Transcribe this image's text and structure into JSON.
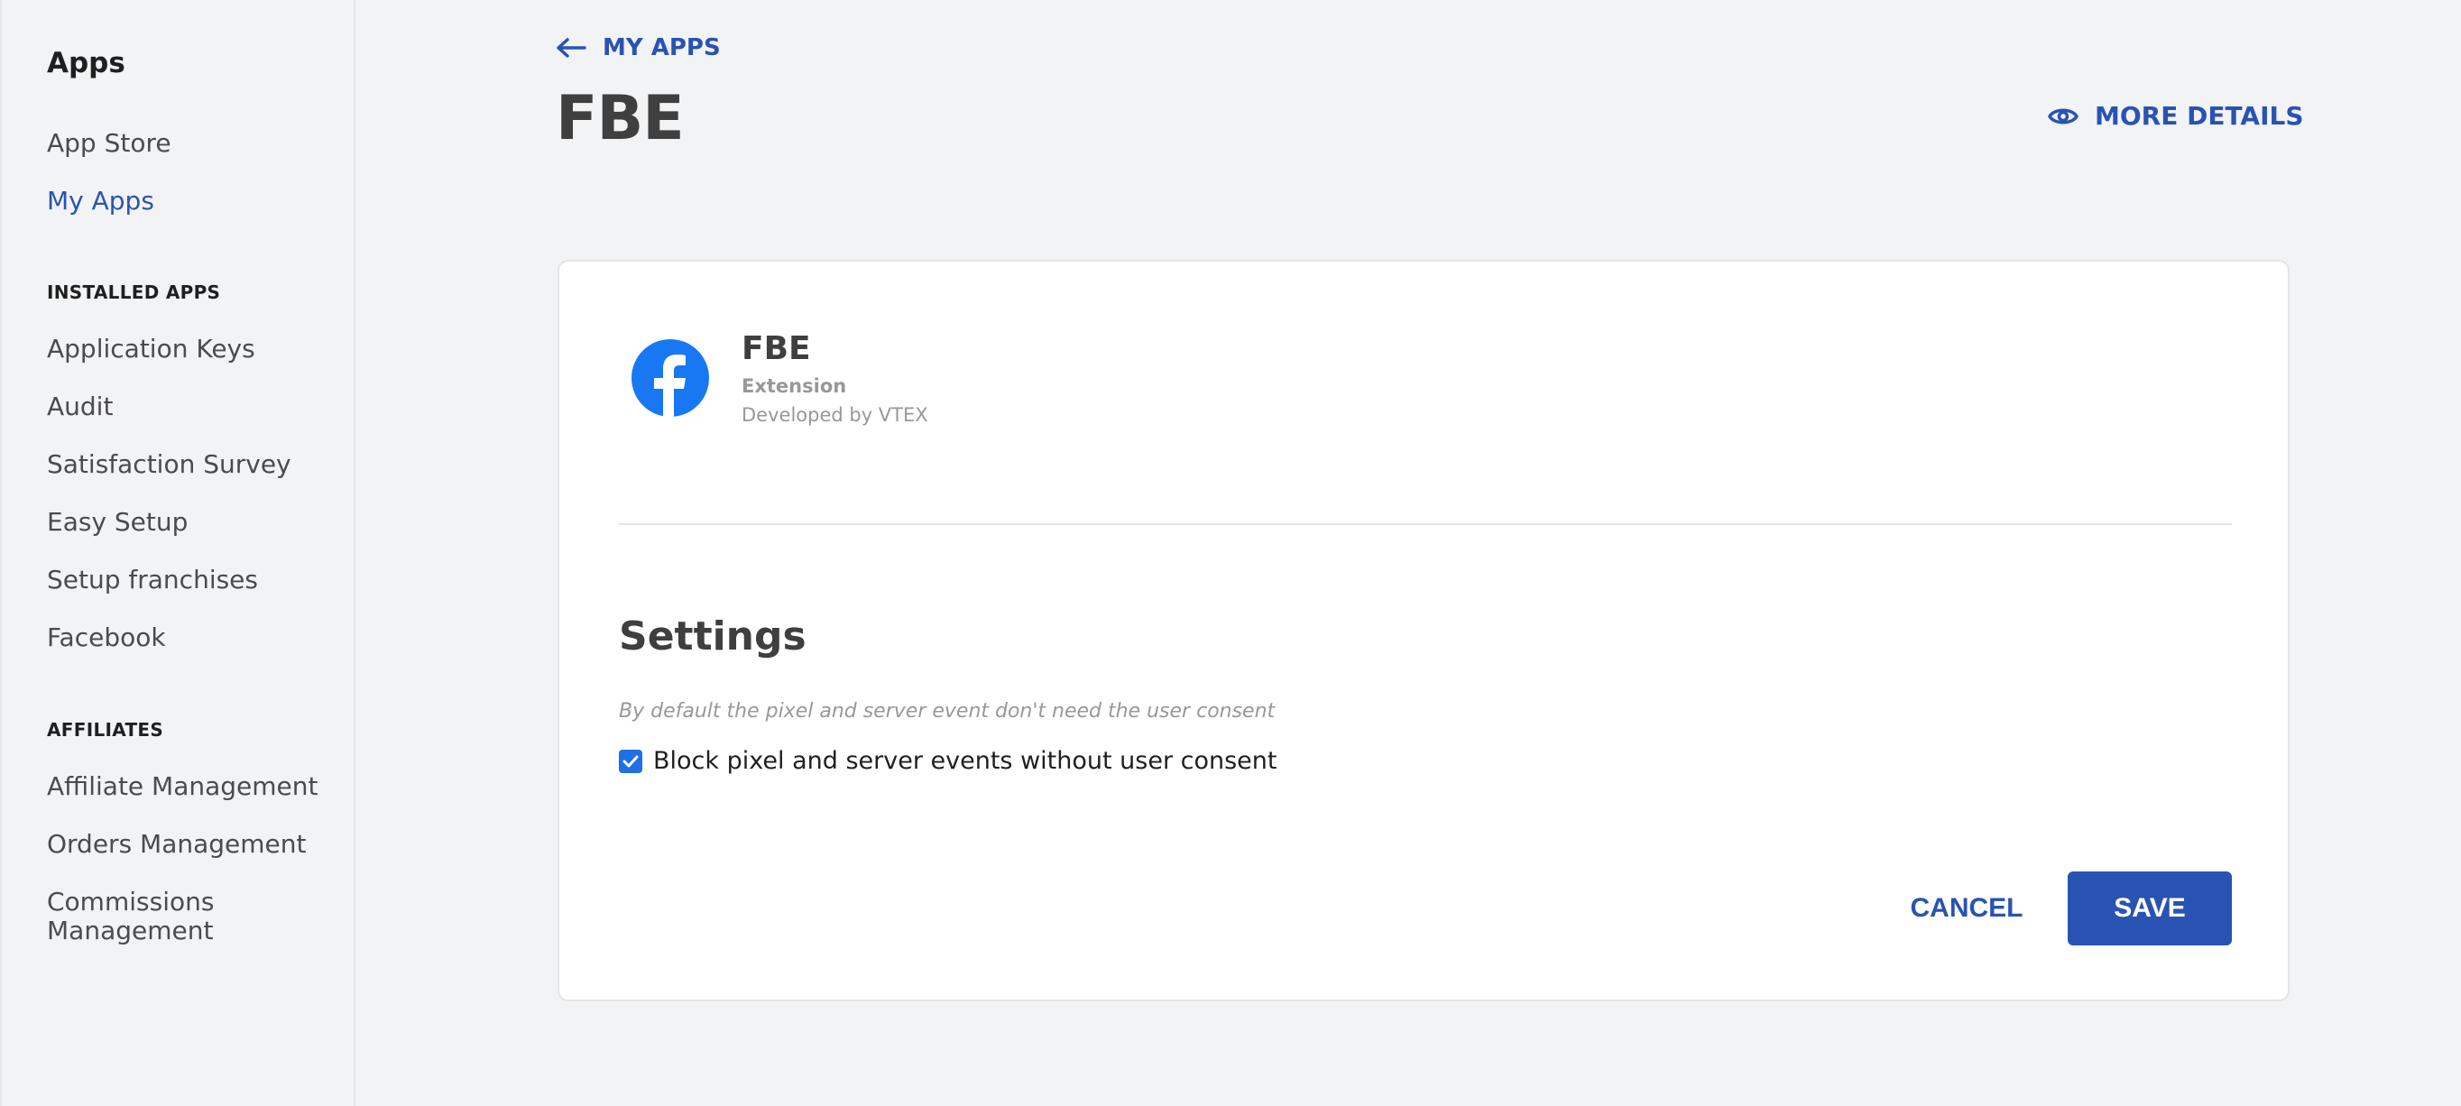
{
  "sidebar": {
    "title": "Apps",
    "main_links": [
      {
        "label": "App Store",
        "active": false
      },
      {
        "label": "My Apps",
        "active": true
      }
    ],
    "sections": [
      {
        "heading": "INSTALLED APPS",
        "items": [
          "Application Keys",
          "Audit",
          "Satisfaction Survey",
          "Easy Setup",
          "Setup franchises",
          "Facebook"
        ]
      },
      {
        "heading": "AFFILIATES",
        "items": [
          "Affiliate Management",
          "Orders Management",
          "Commissions",
          "Management"
        ]
      }
    ]
  },
  "header": {
    "back_label": "MY APPS",
    "title": "FBE",
    "more_details_label": "MORE DETAILS"
  },
  "app": {
    "name": "FBE",
    "type": "Extension",
    "developer": "Developed by VTEX",
    "logo_icon": "facebook-logo-icon"
  },
  "settings": {
    "title": "Settings",
    "hint": "By default the pixel and server event don't need the user consent",
    "checkbox_label": "Block pixel and server events without user consent",
    "checkbox_checked": true
  },
  "actions": {
    "cancel_label": "CANCEL",
    "save_label": "SAVE"
  },
  "colors": {
    "accent": "#2953b2",
    "checkbox": "#1f6fe5",
    "facebook": "#1877f2"
  }
}
